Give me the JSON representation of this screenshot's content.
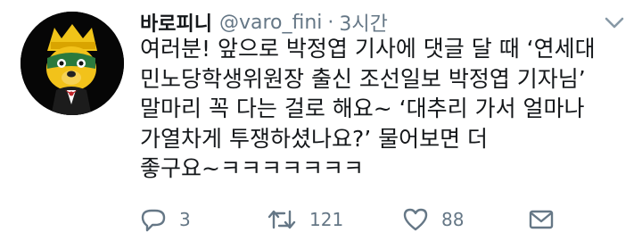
{
  "tweet": {
    "display_name": "바로피니",
    "handle": "@varo_fini",
    "separator": "·",
    "timestamp": "3시간",
    "lines": [
      "여러분! 앞으로 박정엽 기사에 댓글 달 때 ‘연세대",
      "민노당학생위원장 출신 조선일보 박정엽 기자님’",
      "말마리 꼭 다는 걸로 해요~ ‘대추리 가서 얼마나",
      "가열차게 투쟁하셨나요?’ 물어보면 더",
      "좋구요~ㅋㅋㅋㅋㅋㅋㅋ"
    ]
  },
  "actions": {
    "reply_count": "3",
    "retweet_count": "121",
    "like_count": "88"
  },
  "icons": {
    "avatar": "cartoon-character-avatar",
    "caret": "chevron-down-icon",
    "reply": "reply-icon",
    "retweet": "retweet-icon",
    "like": "heart-icon",
    "dm": "envelope-icon"
  },
  "colors": {
    "text": "#14171a",
    "secondary": "#657786",
    "avatar_bg": "#060606"
  }
}
